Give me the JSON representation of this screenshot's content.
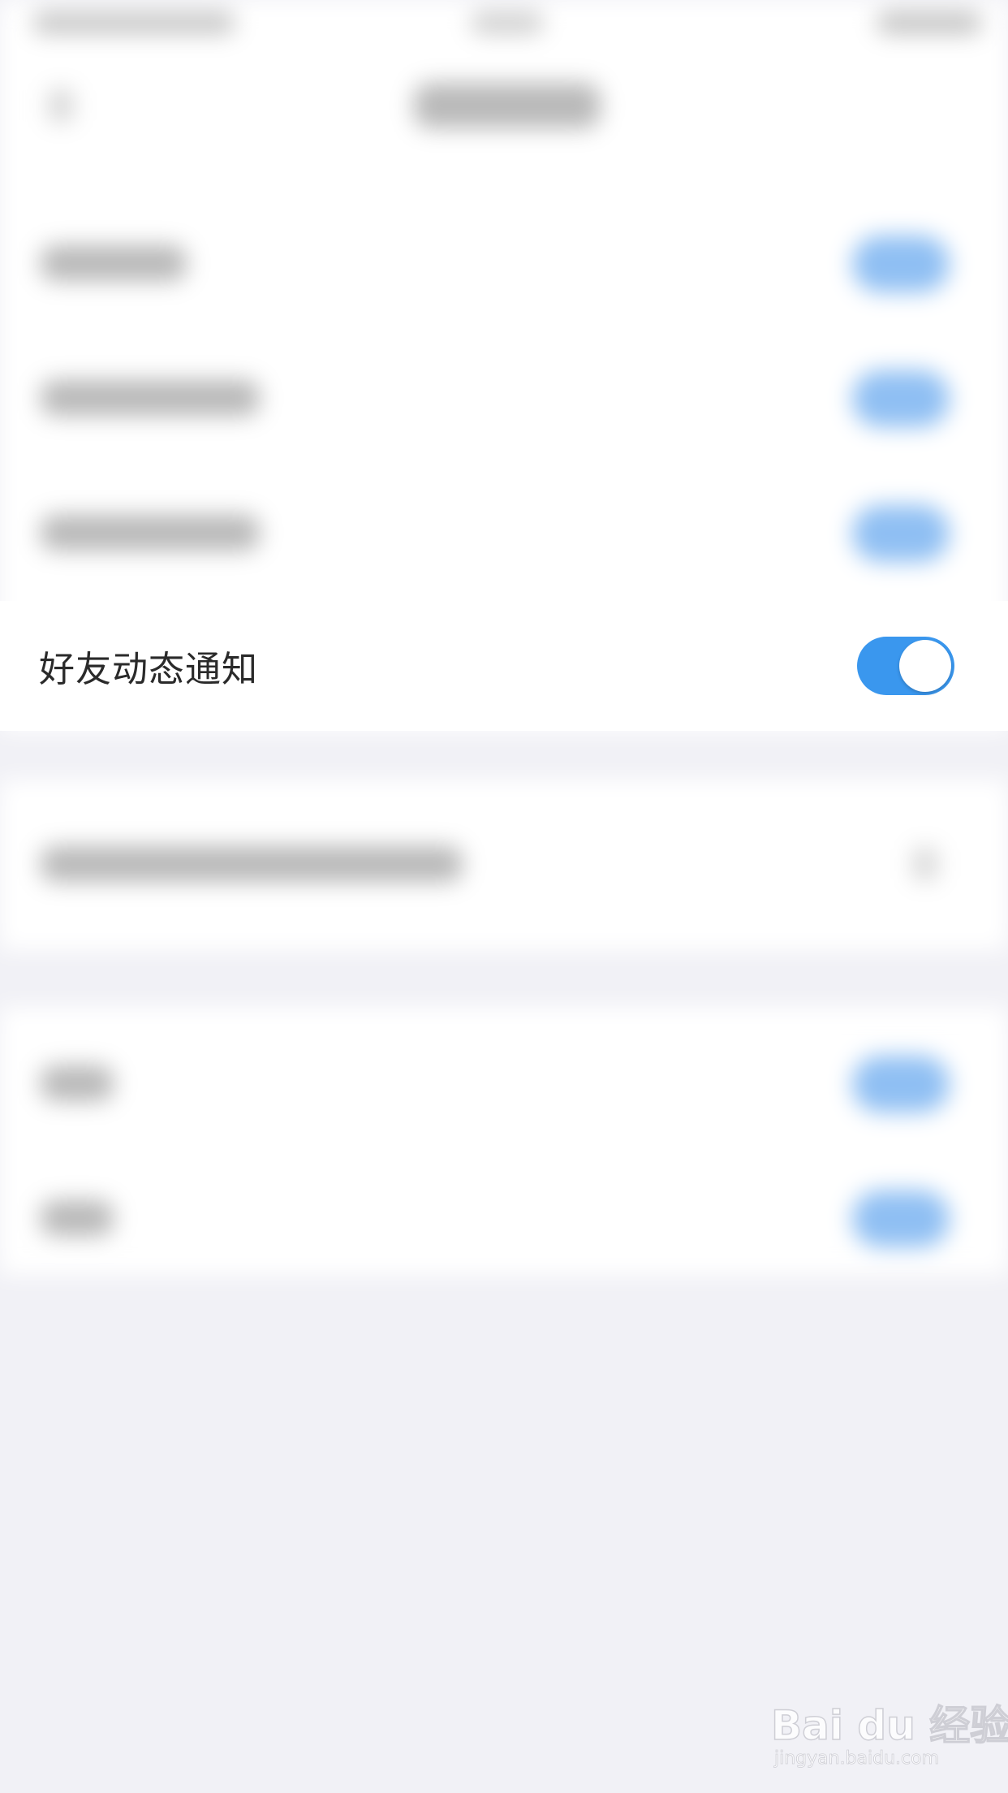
{
  "settings": {
    "focused_item": {
      "label": "好友动态通知",
      "enabled": true
    }
  },
  "colors": {
    "toggle_on": "#3a97ee",
    "page_background": "#f1f1f6",
    "row_background": "#ffffff",
    "label_text": "#2a2a2a"
  },
  "watermark": {
    "logo": "Bai du 经验",
    "url": "jingyan.baidu.com"
  }
}
